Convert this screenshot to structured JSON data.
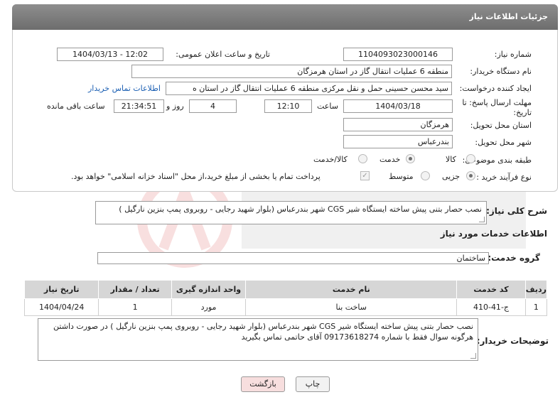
{
  "header": {
    "title": "جزئیات اطلاعات نیاز"
  },
  "fields": {
    "need_number_label": "شماره نیاز:",
    "need_number": "1104093023000146",
    "announce_label": "تاریخ و ساعت اعلان عمومی:",
    "announce_value": "1404/03/13 - 12:02",
    "buyer_org_label": "نام دستگاه خریدار:",
    "buyer_org": "منطقه 6 عملیات انتقال گاز در استان هرمزگان",
    "requester_label": "ایجاد کننده درخواست:",
    "requester": "سید محسن حسینی حمل و نقل مرکزی منطقه 6 عملیات انتقال گاز در استان ه",
    "contact_link": "اطلاعات تماس خریدار",
    "deadline_label": "مهلت ارسال پاسخ: تا تاریخ:",
    "deadline_date": "1404/03/18",
    "time_label": "ساعت",
    "deadline_time": "12:10",
    "days_value": "4",
    "days_label": "روز و",
    "remaining_time": "21:34:51",
    "remaining_label": "ساعت باقی مانده",
    "province_label": "استان محل تحویل:",
    "province": "هرمزگان",
    "city_label": "شهر محل تحویل:",
    "city": "بندرعباس",
    "category_label": "طبقه بندی موضوعی:",
    "category_options": [
      "کالا",
      "خدمت",
      "کالا/خدمت"
    ],
    "process_label": "نوع فرآیند خرید :",
    "process_options": [
      "جزیی",
      "متوسط"
    ],
    "payment_note": "پرداخت تمام یا بخشی از مبلغ خرید،از محل \"اسناد خزانه اسلامی\" خواهد بود."
  },
  "summary": {
    "label": "شرح کلی نیاز:",
    "text": "نصب حصار بتنی پیش ساخته ایستگاه شیر CGS شهر بندرعباس (بلوار شهید رجایی - روبروی پمپ بنزین نارگیل )"
  },
  "services": {
    "section_title": "اطلاعات خدمات مورد نیاز",
    "group_label": "گروه خدمت:",
    "group_value": "ساختمان",
    "columns": [
      "ردیف",
      "کد خدمت",
      "نام خدمت",
      "واحد اندازه گیری",
      "تعداد / مقدار",
      "تاریخ نیاز"
    ],
    "rows": [
      [
        "1",
        "ج-41-410",
        "ساخت بنا",
        "مورد",
        "1",
        "1404/04/24"
      ]
    ]
  },
  "buyer_notes": {
    "label": "توضیحات خریدار:",
    "text": "نصب حصار بتنی پیش ساخته ایستگاه شیر CGS شهر بندرعباس (بلوار شهید رجایی - روبروی پمپ بنزین نارگیل ) در صورت داشتن هرگونه سوال فقط با شماره 09173618274 آقای حاتمی تماس بگیرید"
  },
  "buttons": {
    "print": "چاپ",
    "back": "بازگشت"
  },
  "colors": {
    "link": "#1b5fb3",
    "header": "#7a7a7a",
    "back_button_bg": "#f7dede"
  }
}
